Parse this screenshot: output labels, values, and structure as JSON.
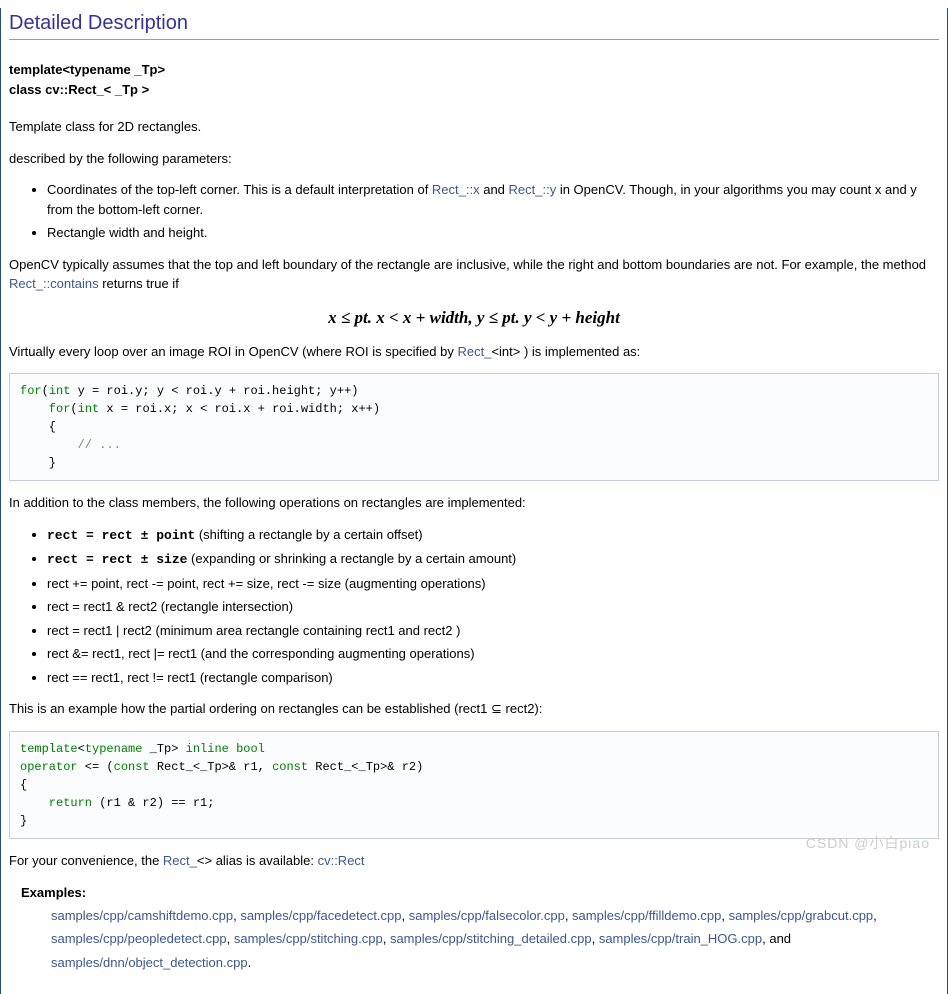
{
  "section_title": "Detailed Description",
  "class_header": {
    "line1": "template<typename _Tp>",
    "line2": "class cv::Rect_< _Tp >"
  },
  "intro1": "Template class for 2D rectangles.",
  "intro2": "described by the following parameters:",
  "params": [
    {
      "pre": "Coordinates of the top-left corner. This is a default interpretation of ",
      "link1": "Rect_::x",
      "mid1": " and ",
      "link2": "Rect_::y",
      "post": " in OpenCV. Though, in your algorithms you may count x and y from the bottom-left corner."
    },
    {
      "pre": "Rectangle width and height.",
      "link1": "",
      "mid1": "",
      "link2": "",
      "post": ""
    }
  ],
  "para_inclusive": {
    "pre": "OpenCV typically assumes that the top and left boundary of the rectangle are inclusive, while the right and bottom boundaries are not. For example, the method ",
    "link": "Rect_::contains",
    "post": " returns true if"
  },
  "math": "x ≤ pt. x < x + width, y ≤ pt. y < y + height",
  "para_loop": {
    "pre": "Virtually every loop over an image ROI in OpenCV (where ROI is specified by ",
    "link": "Rect_",
    "generic": "<int>",
    "post": " ) is implemented as:"
  },
  "code1": {
    "l1a": "for",
    "l1b": "(",
    "l1c": "int",
    "l1d": " y = roi.y; y < roi.y + roi.height; y++)",
    "l2a": "    for",
    "l2b": "(",
    "l2c": "int",
    "l2d": " x = roi.x; x < roi.x + roi.width; x++)",
    "l3": "    {",
    "l4": "        // ...",
    "l5": "    }"
  },
  "para_ops": "In addition to the class members, the following operations on rectangles are implemented:",
  "ops": [
    {
      "bold": "rect = rect ± point",
      "rest": " (shifting a rectangle by a certain offset)"
    },
    {
      "bold": "rect = rect ± size",
      "rest": " (expanding or shrinking a rectangle by a certain amount)"
    },
    {
      "bold": "",
      "rest": "rect += point, rect -= point, rect += size, rect -= size (augmenting operations)"
    },
    {
      "bold": "",
      "rest": "rect = rect1 & rect2 (rectangle intersection)"
    },
    {
      "bold": "",
      "rest": "rect = rect1 | rect2 (minimum area rectangle containing rect1 and rect2 )"
    },
    {
      "bold": "",
      "rest": "rect &= rect1, rect |= rect1 (and the corresponding augmenting operations)"
    },
    {
      "bold": "",
      "rest": "rect == rect1, rect != rect1 (rectangle comparison)"
    }
  ],
  "para_partial": {
    "pre": "This is an example how the partial ordering on rectangles can be established (rect1 ",
    "sym": "⊆",
    "post": " rect2):"
  },
  "code2": {
    "l1a": "template",
    "l1b": "<",
    "l1c": "typename",
    "l1d": " _Tp> ",
    "l1e": "inline",
    "l1f": " ",
    "l1g": "bool",
    "l2a": "operator",
    "l2b": " <= (",
    "l2c": "const",
    "l2d": " Rect_<_Tp>& r1, ",
    "l2e": "const",
    "l2f": " Rect_<_Tp>& r2)",
    "l3": "{",
    "l4a": "    return",
    "l4b": " (r1 & r2) == r1;",
    "l5": "}"
  },
  "para_alias": {
    "pre": "For your convenience, the ",
    "link1": "Rect_",
    "generic": "<>",
    "mid": " alias is available: ",
    "link2": "cv::Rect"
  },
  "examples": {
    "title": "Examples:",
    "items": [
      "samples/cpp/camshiftdemo.cpp",
      "samples/cpp/facedetect.cpp",
      "samples/cpp/falsecolor.cpp",
      "samples/cpp/ffilldemo.cpp",
      "samples/cpp/grabcut.cpp",
      "samples/cpp/peopledetect.cpp",
      "samples/cpp/stitching.cpp",
      "samples/cpp/stitching_detailed.cpp",
      "samples/cpp/train_HOG.cpp",
      "samples/dnn/object_detection.cpp"
    ],
    "and": ", and ",
    "sep": ", ",
    "end": "."
  },
  "watermark": "CSDN @小白piao"
}
